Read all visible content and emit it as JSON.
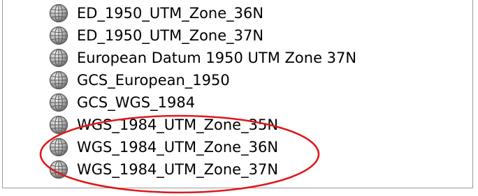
{
  "list": {
    "items": [
      {
        "label": "ED_1950_UTM_Zone_36N",
        "icon": "globe-icon"
      },
      {
        "label": "ED_1950_UTM_Zone_37N",
        "icon": "globe-icon"
      },
      {
        "label": "European Datum 1950 UTM Zone 37N",
        "icon": "globe-icon"
      },
      {
        "label": "GCS_European_1950",
        "icon": "globe-icon"
      },
      {
        "label": "GCS_WGS_1984",
        "icon": "globe-icon"
      },
      {
        "label": "WGS_1984_UTM_Zone_35N",
        "icon": "globe-icon"
      },
      {
        "label": "WGS_1984_UTM_Zone_36N",
        "icon": "globe-icon"
      },
      {
        "label": "WGS_1984_UTM_Zone_37N",
        "icon": "globe-icon"
      }
    ]
  },
  "annotation": {
    "shape": "ellipse",
    "color": "#e0191b",
    "encloses_items": [
      5,
      6,
      7
    ]
  }
}
